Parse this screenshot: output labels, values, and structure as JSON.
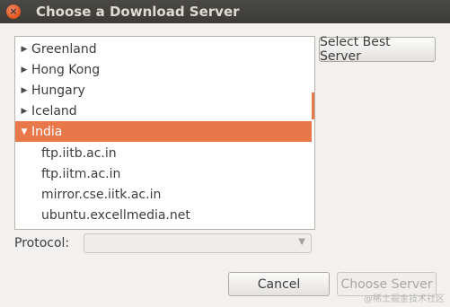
{
  "window": {
    "title": "Choose a Download Server",
    "close_glyph": "×"
  },
  "server_list": {
    "expander_collapsed": "▶",
    "expander_expanded": "▼",
    "rows": [
      {
        "label": "Greenland",
        "expanded": false
      },
      {
        "label": "Hong Kong",
        "expanded": false
      },
      {
        "label": "Hungary",
        "expanded": false
      },
      {
        "label": "Iceland",
        "expanded": false
      },
      {
        "label": "India",
        "expanded": true,
        "selected": true
      }
    ],
    "children": [
      "ftp.iitb.ac.in",
      "ftp.iitm.ac.in",
      "mirror.cse.iitk.ac.in",
      "ubuntu.excellmedia.net"
    ]
  },
  "buttons": {
    "select_best": "Select Best Server",
    "cancel": "Cancel",
    "choose": "Choose Server"
  },
  "protocol": {
    "label": "Protocol:",
    "value": "",
    "arrow": "▼"
  },
  "watermark": "@稀土掘金技术社区",
  "colors": {
    "selection": "#e8784a",
    "titlebar": "#3c3b37"
  }
}
